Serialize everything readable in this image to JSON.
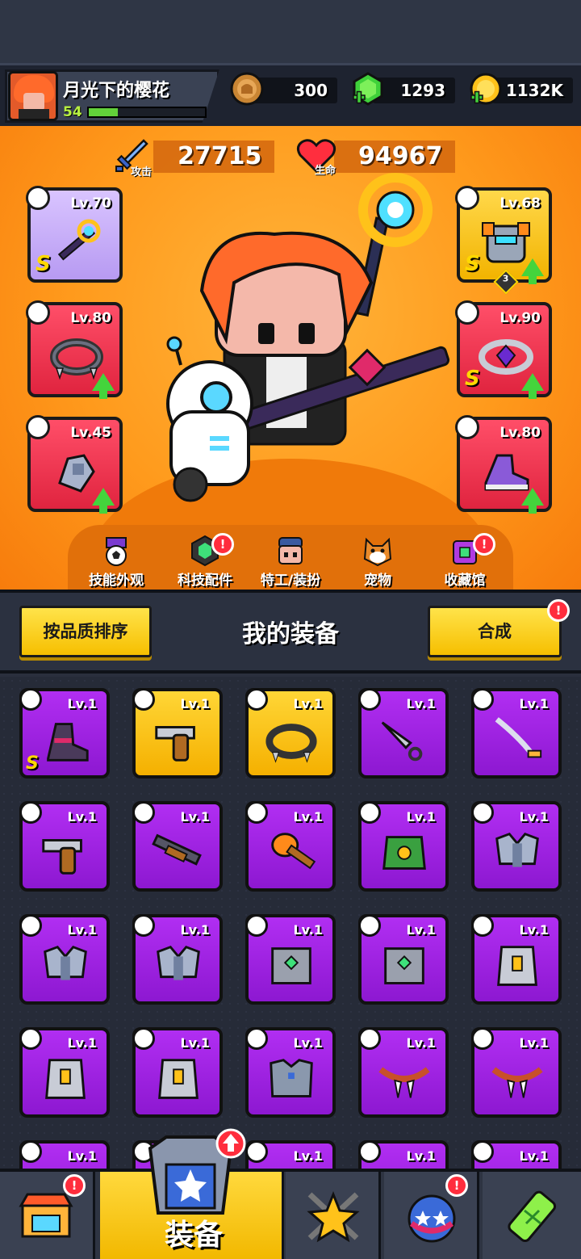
{
  "player": {
    "name": "月光下的樱花",
    "level": "54",
    "xp_fraction": 0.25
  },
  "currencies": {
    "coins": "300",
    "gems": "1293",
    "gold": "1132K"
  },
  "stats": {
    "attack_value": "27715",
    "attack_label": "攻击",
    "hp_value": "94967",
    "hp_label": "生命"
  },
  "equipped": {
    "weapon": {
      "level": "Lv.70",
      "grade": "S"
    },
    "armor": {
      "level": "Lv.68",
      "grade": "S",
      "stars": "3"
    },
    "necklace": {
      "level": "Lv.80"
    },
    "belt": {
      "level": "Lv.90",
      "grade": "S"
    },
    "gloves": {
      "level": "Lv.45"
    },
    "boots": {
      "level": "Lv.80"
    }
  },
  "hero_tabs": [
    {
      "label": "技能外观",
      "icon": "skill-skin-icon"
    },
    {
      "label": "科技配件",
      "icon": "tech-part-icon"
    },
    {
      "label": "特工/装扮",
      "icon": "agent-icon"
    },
    {
      "label": "宠物",
      "icon": "pet-icon"
    },
    {
      "label": "收藏馆",
      "icon": "collection-icon"
    }
  ],
  "equip_header": {
    "sort_label": "按品质排序",
    "title": "我的装备",
    "merge_label": "合成"
  },
  "inventory": [
    {
      "level": "Lv.1",
      "kind": "boots",
      "rarity": "epic",
      "grade": "S"
    },
    {
      "level": "Lv.1",
      "kind": "revolver",
      "rarity": "legend"
    },
    {
      "level": "Lv.1",
      "kind": "necklace",
      "rarity": "legend"
    },
    {
      "level": "Lv.1",
      "kind": "kunai",
      "rarity": "epic"
    },
    {
      "level": "Lv.1",
      "kind": "katana",
      "rarity": "epic"
    },
    {
      "level": "Lv.1",
      "kind": "revolver",
      "rarity": "epic"
    },
    {
      "level": "Lv.1",
      "kind": "shotgun",
      "rarity": "epic"
    },
    {
      "level": "Lv.1",
      "kind": "torch",
      "rarity": "epic"
    },
    {
      "level": "Lv.1",
      "kind": "leaf-armor",
      "rarity": "epic"
    },
    {
      "level": "Lv.1",
      "kind": "armor",
      "rarity": "epic"
    },
    {
      "level": "Lv.1",
      "kind": "armor",
      "rarity": "epic"
    },
    {
      "level": "Lv.1",
      "kind": "armor",
      "rarity": "epic"
    },
    {
      "level": "Lv.1",
      "kind": "vest",
      "rarity": "epic"
    },
    {
      "level": "Lv.1",
      "kind": "vest",
      "rarity": "epic"
    },
    {
      "level": "Lv.1",
      "kind": "plate",
      "rarity": "epic"
    },
    {
      "level": "Lv.1",
      "kind": "plate",
      "rarity": "epic"
    },
    {
      "level": "Lv.1",
      "kind": "plate",
      "rarity": "epic"
    },
    {
      "level": "Lv.1",
      "kind": "police-vest",
      "rarity": "epic"
    },
    {
      "level": "Lv.1",
      "kind": "fang-necklace",
      "rarity": "epic"
    },
    {
      "level": "Lv.1",
      "kind": "fang-necklace",
      "rarity": "epic"
    },
    {
      "level": "Lv.1",
      "kind": "necklace",
      "rarity": "epic"
    },
    {
      "level": "",
      "kind": "necklace",
      "rarity": "epic"
    },
    {
      "level": "Lv.1",
      "kind": "necklace",
      "rarity": "epic"
    },
    {
      "level": "Lv.1",
      "kind": "necklace",
      "rarity": "epic"
    },
    {
      "level": "Lv.1",
      "kind": "necklace",
      "rarity": "epic"
    }
  ],
  "bottom_nav": {
    "equip_label": "装备"
  },
  "notice_mark": "!",
  "colors": {
    "epic": "#9a20dd",
    "legend": "#f7c200",
    "hero_bg": "#ff9a1c",
    "badge": "#ff2d3d"
  }
}
